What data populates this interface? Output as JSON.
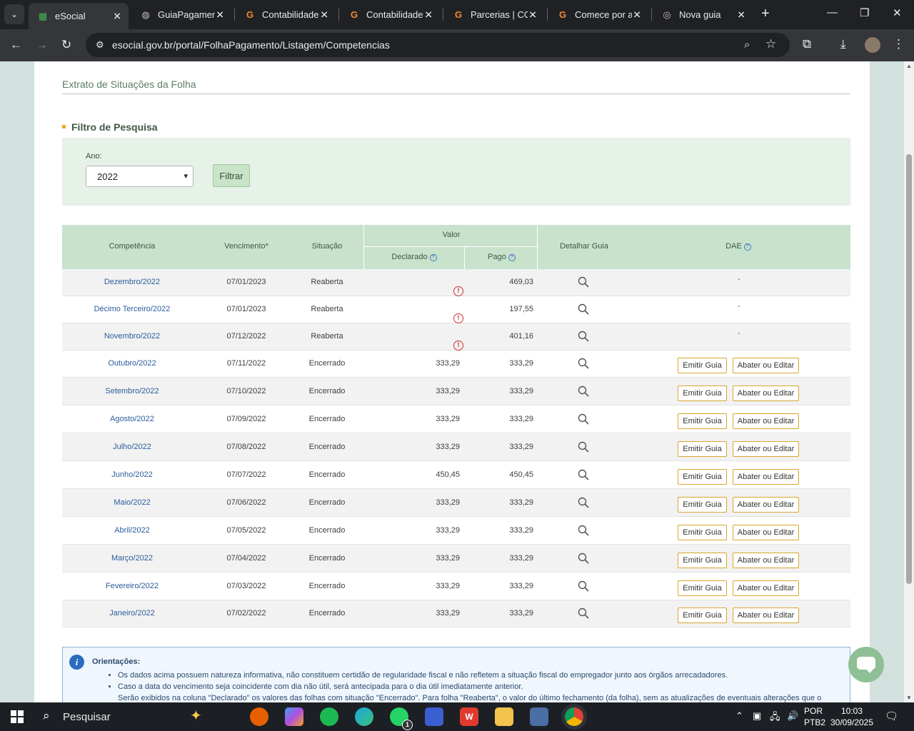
{
  "browser": {
    "tabs": [
      {
        "title": "eSocial",
        "favicon": "esocial-icon",
        "active": true
      },
      {
        "title": "GuiaPagamento",
        "favicon": "globe-icon",
        "active": false
      },
      {
        "title": "Contabilidade",
        "favicon": "g-brand-icon",
        "active": false
      },
      {
        "title": "Contabilidade",
        "favicon": "g-brand-icon",
        "active": false
      },
      {
        "title": "Parcerias | CO",
        "favicon": "g-brand-icon",
        "active": false
      },
      {
        "title": "Comece por a",
        "favicon": "g-brand-icon",
        "active": false
      },
      {
        "title": "Nova guia",
        "favicon": "chrome-icon",
        "active": false
      }
    ],
    "url": "esocial.gov.br/portal/FolhaPagamento/Listagem/Competencias"
  },
  "page": {
    "title": "Extrato de Situações da Folha",
    "filter": {
      "heading": "Filtro de Pesquisa",
      "ano_label": "Ano:",
      "ano_value": "2022",
      "filtrar_label": "Filtrar"
    },
    "table": {
      "headers": {
        "competencia": "Competência",
        "vencimento": "Vencimento*",
        "situacao": "Situação",
        "valor": "Valor",
        "declarado": "Declarado",
        "pago": "Pago",
        "detalhar": "Detalhar Guia",
        "dae": "DAE"
      },
      "rows": [
        {
          "competencia": "Dezembro/2022",
          "vencimento": "07/01/2023",
          "situacao": "Reaberta",
          "declarado": "",
          "pago": "469,03",
          "warning": true,
          "dae": "-"
        },
        {
          "competencia": "Décimo Terceiro/2022",
          "vencimento": "07/01/2023",
          "situacao": "Reaberta",
          "declarado": "",
          "pago": "197,55",
          "warning": true,
          "dae": "-"
        },
        {
          "competencia": "Novembro/2022",
          "vencimento": "07/12/2022",
          "situacao": "Reaberta",
          "declarado": "",
          "pago": "401,16",
          "warning": true,
          "dae": "-"
        },
        {
          "competencia": "Outubro/2022",
          "vencimento": "07/11/2022",
          "situacao": "Encerrado",
          "declarado": "333,29",
          "pago": "333,29",
          "warning": false,
          "dae": ""
        },
        {
          "competencia": "Setembro/2022",
          "vencimento": "07/10/2022",
          "situacao": "Encerrado",
          "declarado": "333,29",
          "pago": "333,29",
          "warning": false,
          "dae": ""
        },
        {
          "competencia": "Agosto/2022",
          "vencimento": "07/09/2022",
          "situacao": "Encerrado",
          "declarado": "333,29",
          "pago": "333,29",
          "warning": false,
          "dae": ""
        },
        {
          "competencia": "Julho/2022",
          "vencimento": "07/08/2022",
          "situacao": "Encerrado",
          "declarado": "333,29",
          "pago": "333,29",
          "warning": false,
          "dae": ""
        },
        {
          "competencia": "Junho/2022",
          "vencimento": "07/07/2022",
          "situacao": "Encerrado",
          "declarado": "450,45",
          "pago": "450,45",
          "warning": false,
          "dae": ""
        },
        {
          "competencia": "Maio/2022",
          "vencimento": "07/06/2022",
          "situacao": "Encerrado",
          "declarado": "333,29",
          "pago": "333,29",
          "warning": false,
          "dae": ""
        },
        {
          "competencia": "Abril/2022",
          "vencimento": "07/05/2022",
          "situacao": "Encerrado",
          "declarado": "333,29",
          "pago": "333,29",
          "warning": false,
          "dae": ""
        },
        {
          "competencia": "Março/2022",
          "vencimento": "07/04/2022",
          "situacao": "Encerrado",
          "declarado": "333,29",
          "pago": "333,29",
          "warning": false,
          "dae": ""
        },
        {
          "competencia": "Fevereiro/2022",
          "vencimento": "07/03/2022",
          "situacao": "Encerrado",
          "declarado": "333,29",
          "pago": "333,29",
          "warning": false,
          "dae": ""
        },
        {
          "competencia": "Janeiro/2022",
          "vencimento": "07/02/2022",
          "situacao": "Encerrado",
          "declarado": "333,29",
          "pago": "333,29",
          "warning": false,
          "dae": ""
        }
      ],
      "btn_emitir": "Emitir Guia",
      "btn_abater": "Abater ou Editar"
    },
    "orientacoes": {
      "heading": "Orientações:",
      "items": [
        "Os dados acima possuem natureza informativa, não constituem certidão de regularidade fiscal e não refletem a situação fiscal do empregador junto aos órgãos arrecadadores.",
        "Caso a data do vencimento seja coincidente com dia não útil, será antecipada para o dia útil imediatamente anterior.",
        "Serão exibidos na coluna \"Declarado\" os valores das folhas com situação \"Encerrado\". Para folha \"Reaberta\", o valor do último fechamento (da folha), sem as atualizações de eventuais alterações que o"
      ]
    }
  },
  "taskbar": {
    "search_placeholder": "Pesquisar",
    "apps": [
      "firefox-icon",
      "copilot-icon",
      "spotify-icon",
      "edge-icon",
      "whatsapp-icon",
      "store-icon",
      "wps-icon",
      "file-explorer-icon",
      "calculator-icon",
      "chrome-icon"
    ],
    "whatsapp_badge": "1",
    "lang_line1": "POR",
    "lang_line2": "PTB2",
    "time": "10:03",
    "date": "30/09/2025"
  },
  "colors": {
    "header_green": "#c8e2cc",
    "filter_bg": "#e6f1e8",
    "link_blue": "#2a5d9c",
    "button_border": "#d8a630",
    "warning_red": "#d0302b"
  }
}
